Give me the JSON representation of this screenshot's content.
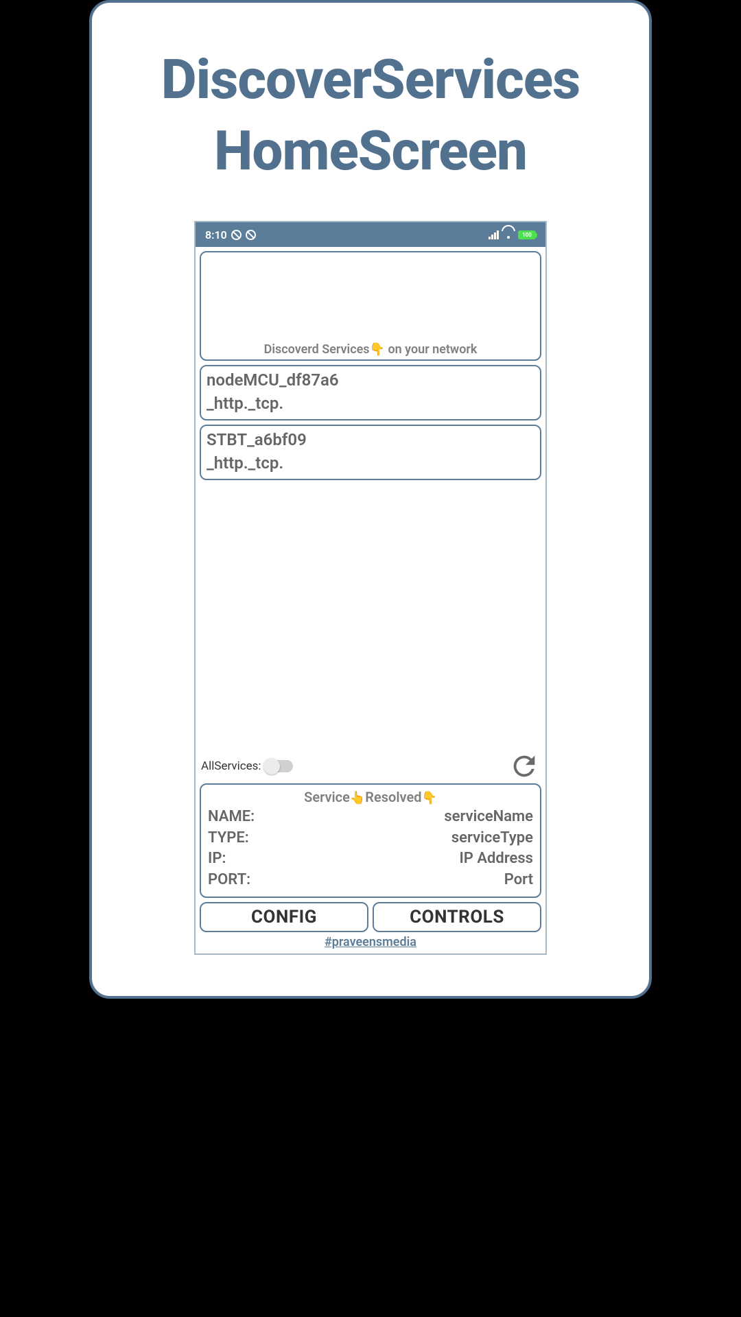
{
  "page": {
    "title_line1": "DiscoverServices",
    "title_line2": "HomeScreen"
  },
  "statusbar": {
    "time": "8:10",
    "battery": "100"
  },
  "discovery": {
    "header_prefix": "Discoverd Services",
    "header_emoji": "👇",
    "header_suffix": " on your network",
    "services": [
      {
        "name": "nodeMCU_df87a6",
        "type": "_http._tcp."
      },
      {
        "name": "STBT_a6bf09",
        "type": "_http._tcp."
      }
    ]
  },
  "toggle": {
    "label": "AllServices:",
    "on": false
  },
  "resolved": {
    "title_prefix": "Service",
    "title_mid_emoji": "👆",
    "title_mid": "Resolved",
    "title_end_emoji": "👇",
    "rows": [
      {
        "key": "NAME:",
        "value": "serviceName"
      },
      {
        "key": "TYPE:",
        "value": "serviceType"
      },
      {
        "key": "IP:",
        "value": "IP Address"
      },
      {
        "key": "PORT:",
        "value": "Port"
      }
    ]
  },
  "buttons": {
    "config": "CONFIG",
    "controls": "CONTROLS"
  },
  "footer": {
    "link": "#praveensmedia"
  }
}
